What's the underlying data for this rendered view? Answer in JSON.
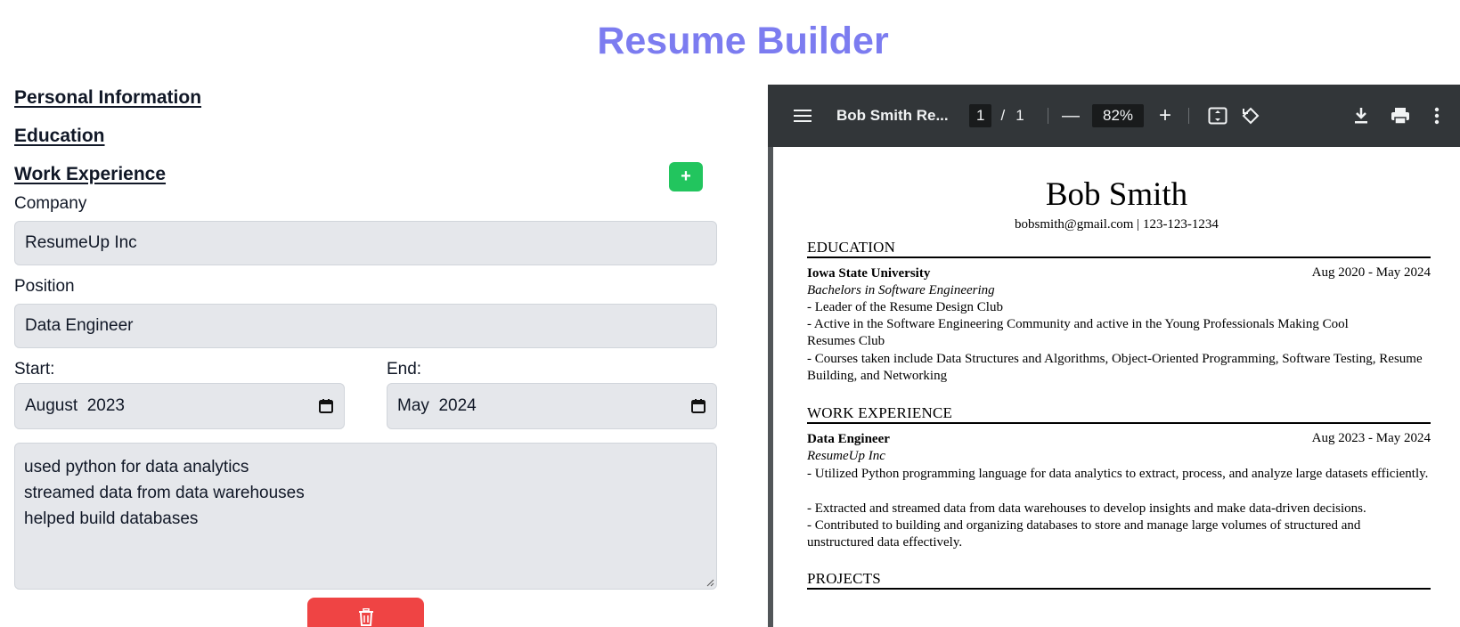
{
  "app": {
    "title": "Resume Builder"
  },
  "form": {
    "sections": {
      "personal": "Personal Information",
      "education": "Education",
      "work": "Work Experience"
    },
    "add_label": "+",
    "company": {
      "label": "Company",
      "value": "ResumeUp Inc"
    },
    "position": {
      "label": "Position",
      "value": "Data Engineer"
    },
    "start": {
      "label": "Start:",
      "month": "August",
      "year": "2023"
    },
    "end": {
      "label": "End:",
      "month": "May",
      "year": "2024"
    },
    "description_lines": [
      "used python for data analytics",
      "streamed data from data warehouses",
      "helped build databases"
    ]
  },
  "viewer": {
    "doc_title": "Bob Smith Re...",
    "page_current": "1",
    "page_sep": "/",
    "page_total": "1",
    "zoom": "82%",
    "zoom_out": "—",
    "zoom_in": "+"
  },
  "resume": {
    "name": "Bob Smith",
    "contact": "bobsmith@gmail.com | 123-123-1234",
    "education_heading": "EDUCATION",
    "school": "Iowa State University",
    "school_dates": "Aug 2020 - May 2024",
    "degree": "Bachelors in Software Engineering",
    "edu_bullets": [
      "- Leader of the Resume Design Club",
      "- Active in the Software Engineering Community and active in the Young Professionals Making Cool Resumes Club",
      "- Courses taken include Data Structures and Algorithms, Object-Oriented Programming, Software Testing, Resume Building, and Networking"
    ],
    "work_heading": "WORK EXPERIENCE",
    "job_title": "Data Engineer",
    "job_dates": "Aug 2023 - May 2024",
    "company": "ResumeUp Inc",
    "work_bullets": [
      "- Utilized Python programming language for data analytics to extract, process, and analyze large datasets efficiently.",
      "- Extracted and streamed data from data warehouses to develop insights and make data-driven decisions.",
      "- Contributed to building and organizing databases to store and manage large volumes of structured and unstructured data effectively."
    ],
    "projects_heading": "PROJECTS"
  },
  "icons": {
    "add": "plus-icon",
    "calendar": "calendar-icon",
    "delete": "trash-icon",
    "menu": "hamburger-icon",
    "fit": "fit-page-icon",
    "rotate": "rotate-icon",
    "download": "download-icon",
    "print": "print-icon",
    "more": "more-vert-icon"
  },
  "colors": {
    "title": "#7c7cf0",
    "add_button": "#22c55e",
    "delete_button": "#ef4444",
    "input_bg": "#e5e7eb",
    "toolbar_bg": "#323639"
  }
}
